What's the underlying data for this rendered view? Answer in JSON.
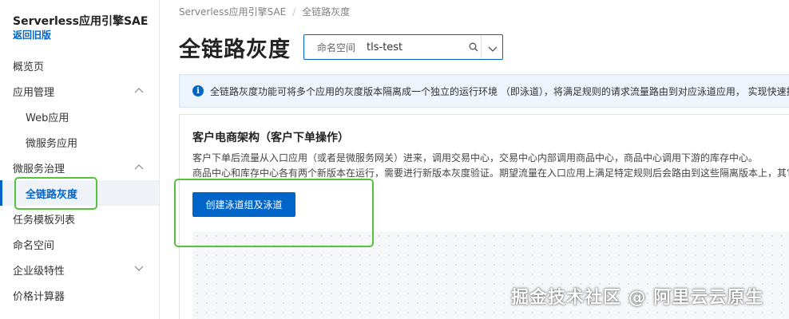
{
  "sidebar": {
    "title": "Serverless应用引擎SAE",
    "back_link": "返回旧版",
    "items": [
      {
        "label": "概览页"
      },
      {
        "label": "应用管理"
      },
      {
        "label": "Web应用"
      },
      {
        "label": "微服务应用"
      },
      {
        "label": "微服务治理"
      },
      {
        "label": "全链路灰度"
      },
      {
        "label": "任务模板列表"
      },
      {
        "label": "命名空间"
      },
      {
        "label": "企业级特性"
      },
      {
        "label": "价格计算器"
      }
    ]
  },
  "breadcrumb": [
    "Serverless应用引擎SAE",
    "全链路灰度"
  ],
  "page_title": "全链路灰度",
  "namespace_select": {
    "label": "命名空间",
    "value": "tls-test"
  },
  "info_bar": {
    "text": "全链路灰度功能可将多个应用的灰度版本隔离成一个独立的运行环境 （即泳道），将满足规则的请求流量路由到对应泳道应用， 实现快速搭"
  },
  "card": {
    "title": "客户电商架构（客户下单操作）",
    "desc_line1": "客户下单后流量从入口应用（或者是微服务网关）进来，调用交易中心，交易中心内部调用商品中心，商品中心调用下游的库存中心。",
    "desc_line2": "商品中心和库存中心各有两个新版本在运行，需要进行新版本灰度验证。期望流量在入口应用上满足特定规则后会路由到这些隔离版本上，其它",
    "button_label": "创建泳道组及泳道"
  },
  "watermark": "掘金技术社区 @ 阿里云云原生",
  "colors": {
    "accent": "#0064c8",
    "highlight": "#55c33b",
    "info_bg": "#eef4fb"
  }
}
